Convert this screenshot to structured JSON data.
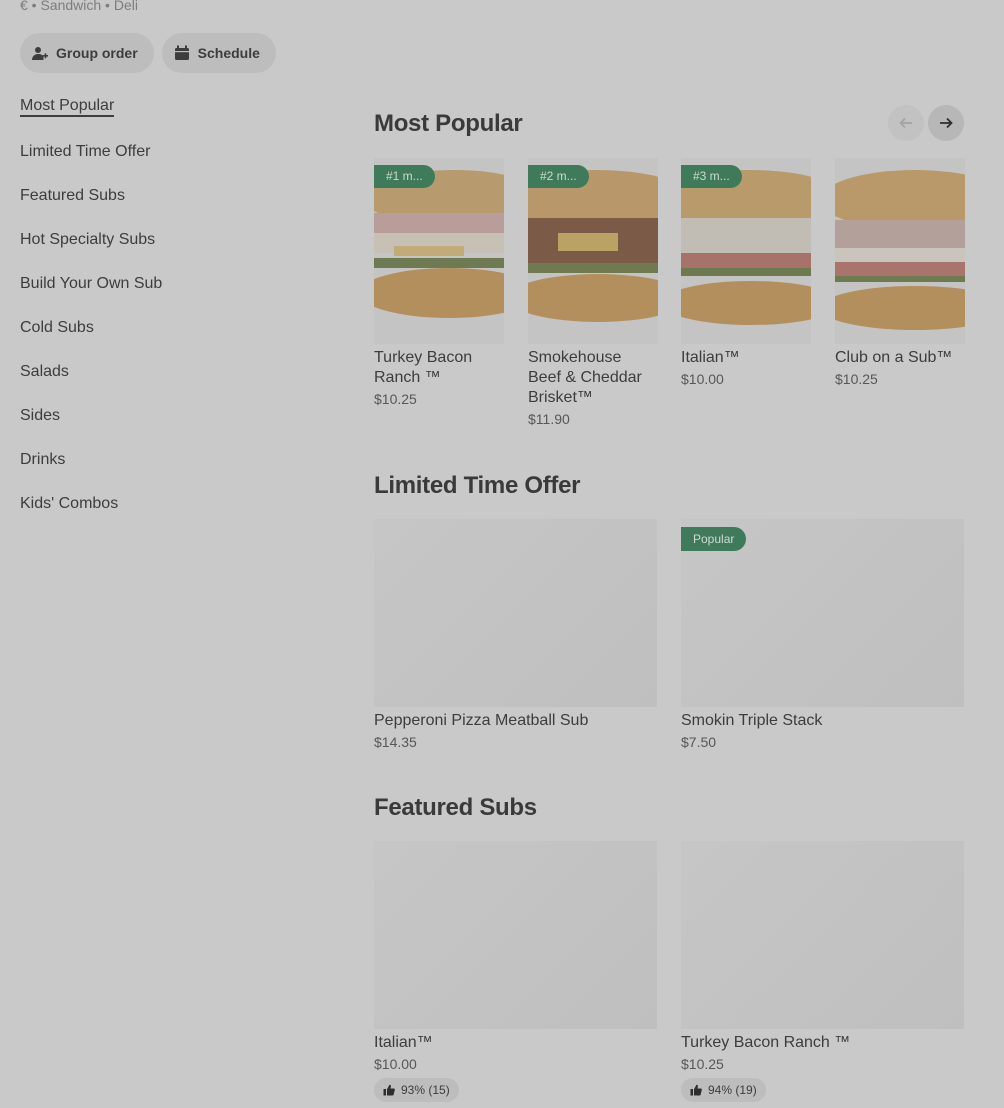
{
  "store": {
    "meta": "€ • Sandwich • Deli"
  },
  "actions": {
    "group_order": "Group order",
    "schedule": "Schedule"
  },
  "sidebar": {
    "items": [
      {
        "label": "Most Popular"
      },
      {
        "label": "Limited Time Offer"
      },
      {
        "label": "Featured Subs"
      },
      {
        "label": "Hot Specialty Subs"
      },
      {
        "label": "Build Your Own Sub"
      },
      {
        "label": "Cold Subs"
      },
      {
        "label": "Salads"
      },
      {
        "label": "Sides"
      },
      {
        "label": "Drinks"
      },
      {
        "label": "Kids' Combos"
      }
    ]
  },
  "most_popular": {
    "title": "Most Popular",
    "items": [
      {
        "badge": "#1 m...",
        "name": "Turkey Bacon Ranch ™",
        "price": "$10.25"
      },
      {
        "badge": "#2 m...",
        "name": "Smokehouse Beef & Cheddar Brisket™",
        "price": "$11.90"
      },
      {
        "badge": "#3 m...",
        "name": "Italian™",
        "price": "$10.00"
      },
      {
        "badge": "",
        "name": "Club on a Sub™",
        "price": "$10.25"
      }
    ]
  },
  "limited_time": {
    "title": "Limited Time Offer",
    "items": [
      {
        "name": "Pepperoni Pizza Meatball Sub",
        "price": "$14.35",
        "tag": ""
      },
      {
        "name": "Smokin Triple Stack",
        "price": "$7.50",
        "tag": "Popular"
      }
    ]
  },
  "featured": {
    "title": "Featured Subs",
    "items": [
      {
        "name": "Italian™",
        "price": "$10.00",
        "rating": "93% (15)"
      },
      {
        "name": "Turkey Bacon Ranch ™",
        "price": "$10.25",
        "rating": "94% (19)"
      }
    ]
  },
  "colors": {
    "badge_green": "#3f7b5a",
    "background": "#c9c9c9"
  }
}
